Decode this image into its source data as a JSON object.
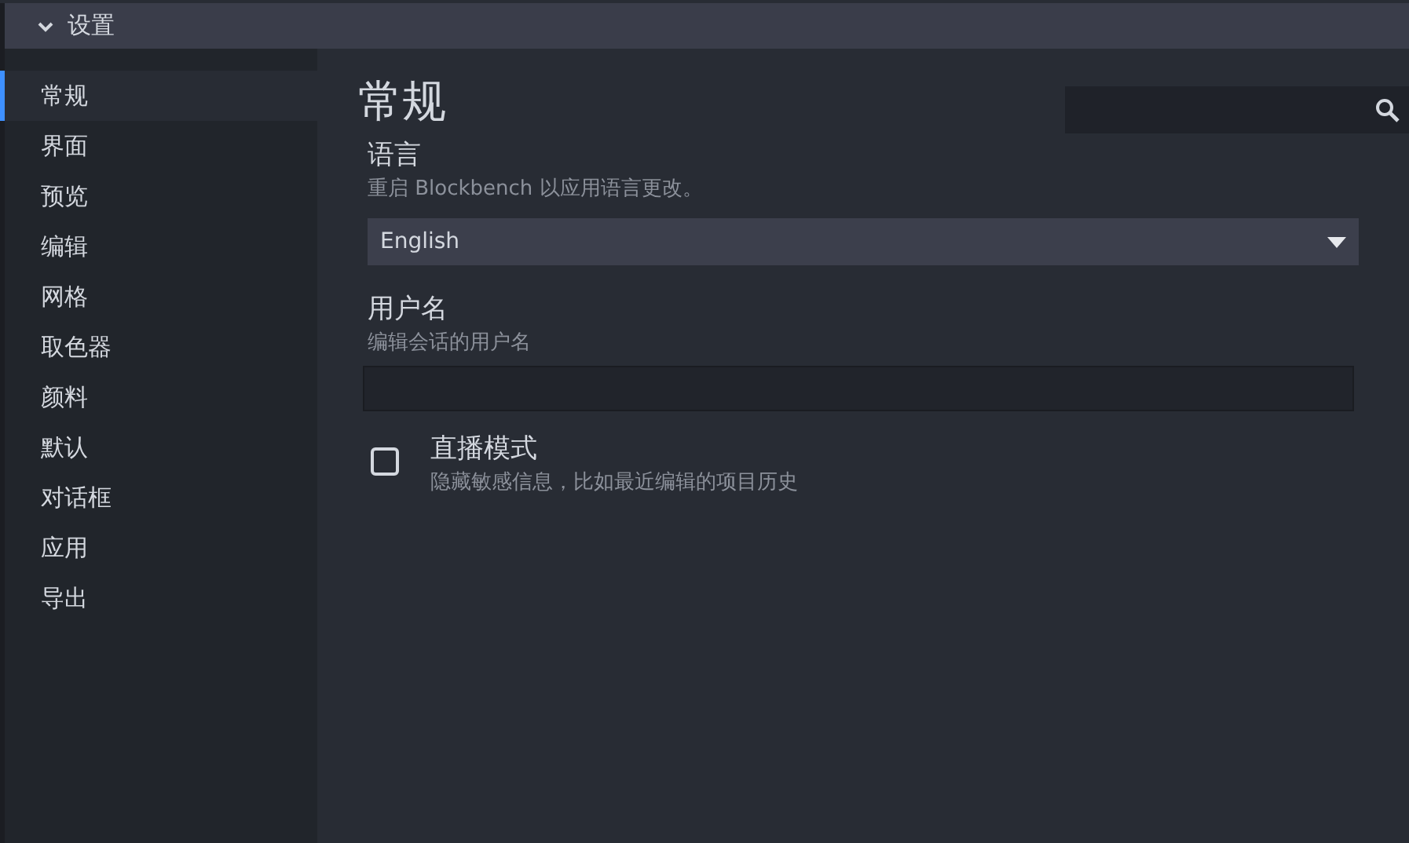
{
  "dialog": {
    "title": "设置",
    "expanded": true
  },
  "sidebar": {
    "items": [
      {
        "label": "常规",
        "selected": true
      },
      {
        "label": "界面",
        "selected": false
      },
      {
        "label": "预览",
        "selected": false
      },
      {
        "label": "编辑",
        "selected": false
      },
      {
        "label": "网格",
        "selected": false
      },
      {
        "label": "取色器",
        "selected": false
      },
      {
        "label": "颜料",
        "selected": false
      },
      {
        "label": "默认",
        "selected": false
      },
      {
        "label": "对话框",
        "selected": false
      },
      {
        "label": "应用",
        "selected": false
      },
      {
        "label": "导出",
        "selected": false
      }
    ]
  },
  "section": {
    "title": "常规",
    "settings": [
      {
        "kind": "select",
        "label": "语言",
        "description": "重启 Blockbench 以应用语言更改。",
        "value": "English"
      },
      {
        "kind": "text",
        "label": "用户名",
        "description": "编辑会话的用户名"
      },
      {
        "kind": "checkbox",
        "label": "直播模式",
        "description": "隐藏敏感信息，比如最近编辑的项目历史",
        "checked": false
      }
    ]
  }
}
